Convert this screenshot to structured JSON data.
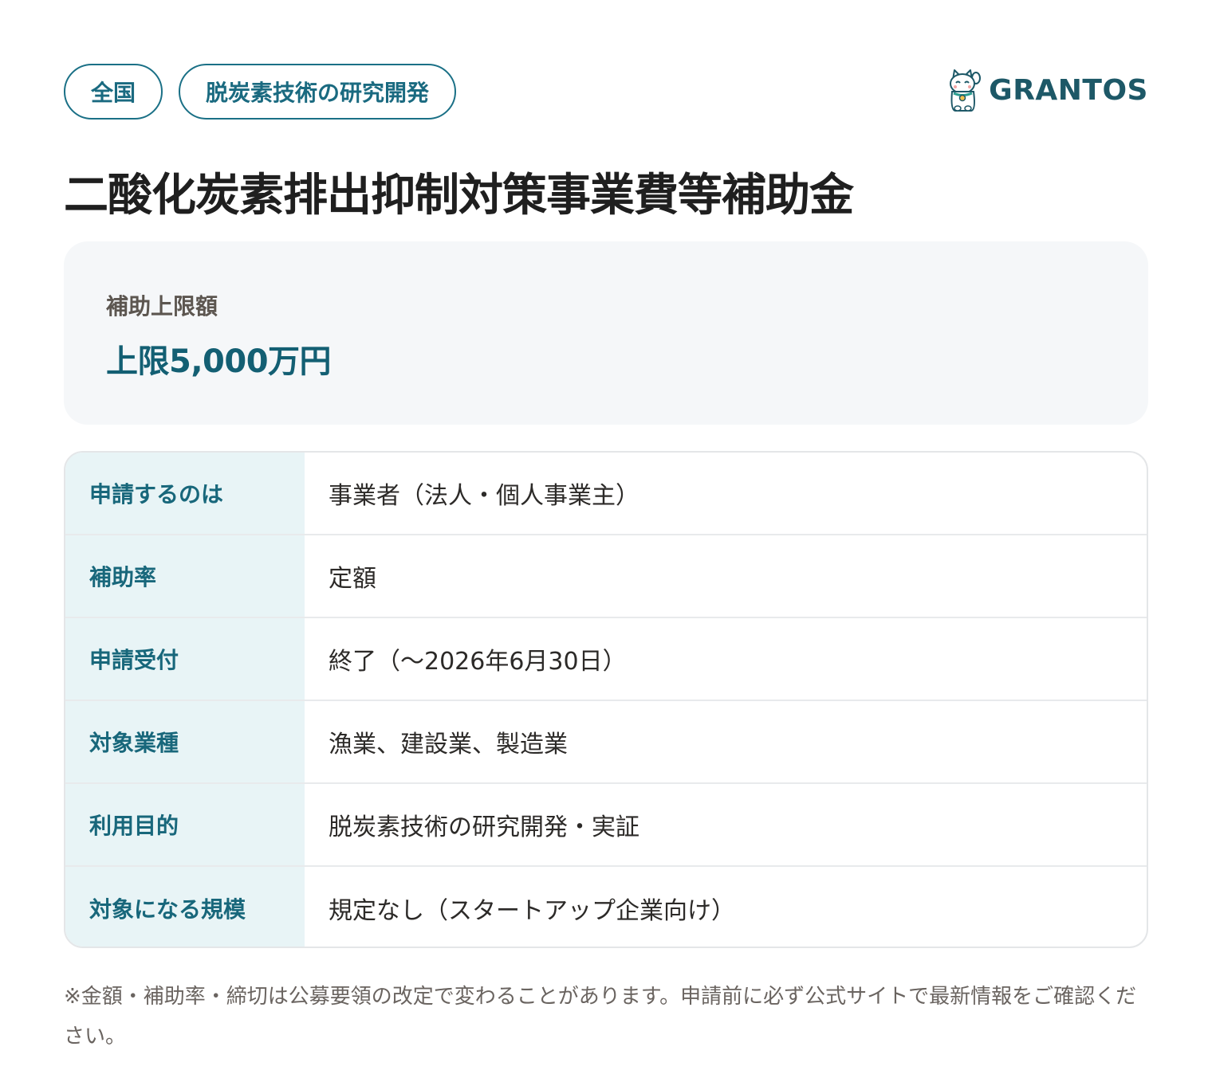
{
  "tags": [
    "全国",
    "脱炭素技術の研究開発"
  ],
  "brand": {
    "name": "GRANTOS",
    "logo_icon": "maneki-neko-cat-icon"
  },
  "title": "二酸化炭素排出抑制対策事業費等補助金",
  "amount": {
    "label": "補助上限額",
    "value": "上限5,000万円"
  },
  "rows": [
    {
      "key": "申請するのは",
      "value": "事業者（法人・個人事業主）"
    },
    {
      "key": "補助率",
      "value": "定額"
    },
    {
      "key": "申請受付",
      "value": "終了（〜2026年6月30日）"
    },
    {
      "key": "対象業種",
      "value": "漁業、建設業、製造業"
    },
    {
      "key": "利用目的",
      "value": "脱炭素技術の研究開発・実証"
    },
    {
      "key": "対象になる規模",
      "value": "規定なし（スタートアップ企業向け）"
    }
  ],
  "note": "※金額・補助率・締切は公募要領の改定で変わることがあります。申請前に必ず公式サイトで最新情報をご確認ください。",
  "colors": {
    "accent": "#1a7086",
    "key_bg": "#e8f4f6",
    "card_bg": "#f5f7f9"
  }
}
